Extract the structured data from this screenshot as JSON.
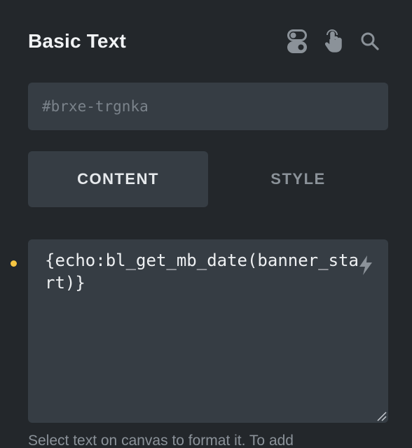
{
  "panel": {
    "title": "Basic Text",
    "icons": [
      "toggle-icon",
      "pointer-hand-icon",
      "search-icon"
    ]
  },
  "id_field": {
    "placeholder": "#brxe-trgnka"
  },
  "tabs": [
    {
      "label": "CONTENT",
      "active": true
    },
    {
      "label": "STYLE",
      "active": false
    }
  ],
  "editor": {
    "value": "{echo:bl_get_mb_date(banner_start)}",
    "modified_indicator_color": "#f5c542"
  },
  "hint": "Select text on canvas to format it. To add",
  "colors": {
    "background": "#23272b",
    "field": "#363d44",
    "text": "#f1f3f5",
    "muted": "#8b9299",
    "accent": "#f5c542"
  }
}
